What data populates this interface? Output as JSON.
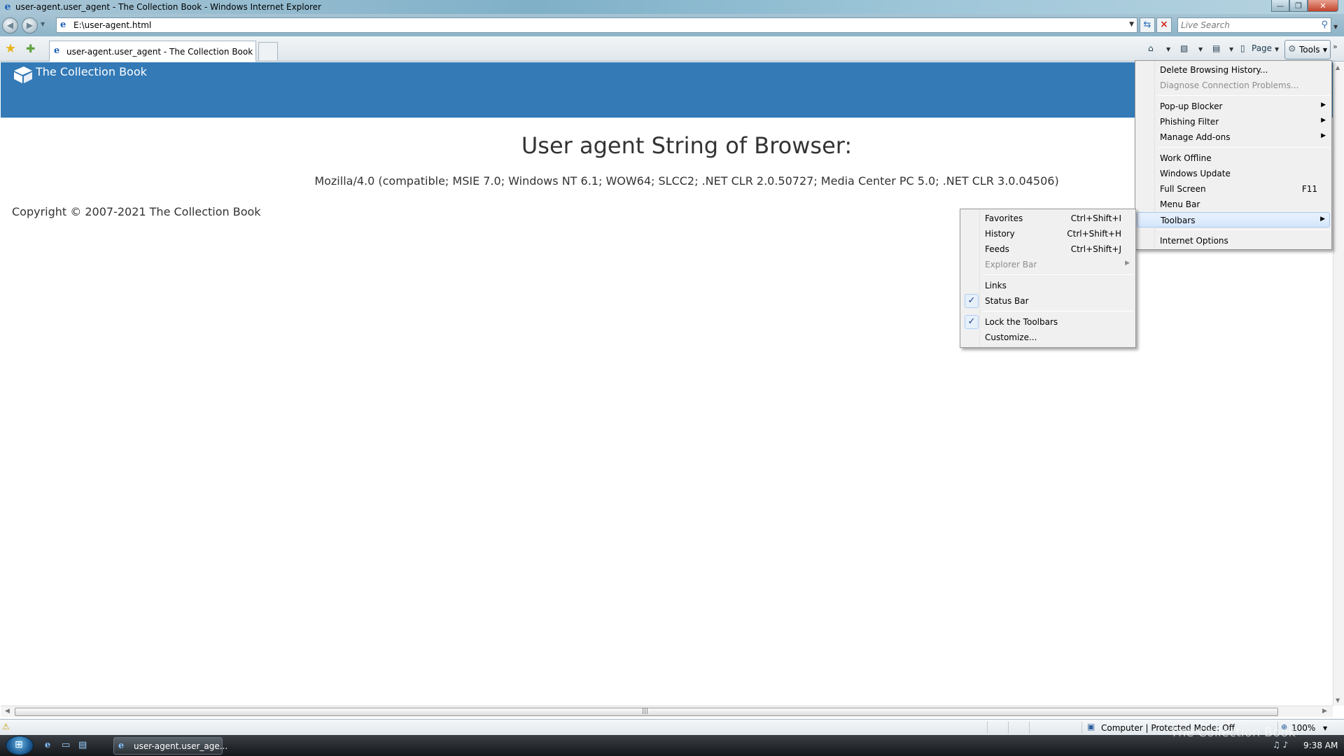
{
  "window": {
    "title": "user-agent.user_agent - The Collection Book - Windows Internet Explorer",
    "minimize": "—",
    "maximize": "❐",
    "close": "✕"
  },
  "nav": {
    "address": "E:\\user-agent.html",
    "search_placeholder": "Live Search"
  },
  "tabs": [
    {
      "label": "user-agent.user_agent - The Collection Book"
    }
  ],
  "command_bar": {
    "page_label": "Page",
    "tools_label": "Tools"
  },
  "page": {
    "brand": "The Collection Book",
    "heading": "User agent String of Browser:",
    "user_agent": "Mozilla/4.0 (compatible; MSIE 7.0; Windows NT 6.1; WOW64; SLCC2; .NET CLR 2.0.50727; Media Center PC 5.0; .NET CLR 3.0.04506)",
    "copyright": "Copyright © 2007-2021 The Collection Book"
  },
  "tools_menu": {
    "items": [
      {
        "label": "Delete Browsing History...",
        "disabled": false
      },
      {
        "label": "Diagnose Connection Problems...",
        "disabled": true
      },
      {
        "label": "Pop-up Blocker",
        "submenu": true
      },
      {
        "label": "Phishing Filter",
        "submenu": true
      },
      {
        "label": "Manage Add-ons",
        "submenu": true
      },
      {
        "label": "Work Offline"
      },
      {
        "label": "Windows Update"
      },
      {
        "label": "Full Screen",
        "shortcut": "F11"
      },
      {
        "label": "Menu Bar"
      },
      {
        "label": "Toolbars",
        "submenu": true,
        "highlighted": true
      },
      {
        "label": "Internet Options"
      }
    ]
  },
  "view_submenu": {
    "items": [
      {
        "label": "Favorites",
        "shortcut": "Ctrl+Shift+I"
      },
      {
        "label": "History",
        "shortcut": "Ctrl+Shift+H"
      },
      {
        "label": "Feeds",
        "shortcut": "Ctrl+Shift+J"
      },
      {
        "label": "Explorer Bar",
        "disabled": true,
        "submenu": true
      },
      {
        "label": "Links"
      },
      {
        "label": "Status Bar",
        "checked": true
      },
      {
        "label": "Lock the Toolbars",
        "checked": true
      },
      {
        "label": "Customize..."
      }
    ]
  },
  "status": {
    "zone": "Computer | Protected Mode: Off",
    "zoom": "100%"
  },
  "taskbar": {
    "task_label": "user-agent.user_age...",
    "clock": "9:38 AM",
    "watermark": "The Collection Book"
  },
  "colors": {
    "banner": "#337ab7",
    "menu_highlight": "#d4e6fc"
  }
}
